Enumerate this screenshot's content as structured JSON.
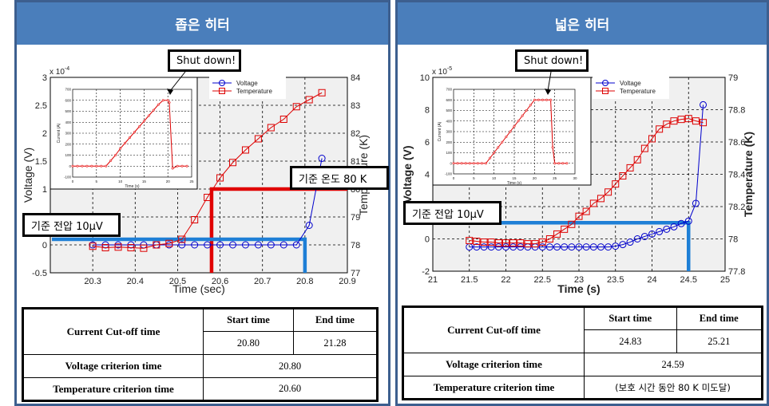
{
  "panels": [
    {
      "title": "좁은 히터",
      "callouts": {
        "shutdown": "Shut down!",
        "temp_ref": "기준 온도 80 K",
        "volt_ref": "기준 전압 10μV"
      },
      "table": {
        "row1_label": "Current Cut-off time",
        "start_header": "Start time",
        "end_header": "End  time",
        "start_value": "20.80",
        "end_value": "21.28",
        "row2_label": "Voltage criterion time",
        "row2_value": "20.80",
        "row3_label": "Temperature criterion time",
        "row3_value": "20.60"
      }
    },
    {
      "title": "넓은 히터",
      "callouts": {
        "shutdown": "Shut down!",
        "volt_ref": "기준 전압 10μV"
      },
      "table": {
        "row1_label": "Current Cut-off time",
        "start_header": "Start time",
        "end_header": "End  time",
        "start_value": "24.83",
        "end_value": "25.21",
        "row2_label": "Voltage criterion time",
        "row2_value": "24.59",
        "row3_label": "Temperature criterion time",
        "row3_value": "(보호 시간 동안 80 K 미도달)"
      }
    }
  ],
  "chart_data": [
    {
      "type": "line",
      "title": "",
      "xlabel": "Time (sec)",
      "ylabel": "Voltage (V)",
      "y2label": "Temperature (K)",
      "yscale_note": "x 10^-4",
      "xlim": [
        20.2,
        20.9
      ],
      "ylim": [
        -0.5,
        3
      ],
      "y2lim": [
        77,
        84
      ],
      "xticks": [
        "20.3",
        "20.4",
        "20.5",
        "20.6",
        "20.7",
        "20.8",
        "20.9"
      ],
      "yticks": [
        "-0.5",
        "0",
        "0.5",
        "1",
        "1.5",
        "2",
        "2.5",
        "3"
      ],
      "y2ticks": [
        "77",
        "78",
        "79",
        "80",
        "81",
        "82",
        "83",
        "84"
      ],
      "grid": true,
      "legend": {
        "position": "top-right",
        "entries": [
          "Voltage",
          "Temperature"
        ]
      },
      "series": [
        {
          "name": "Voltage",
          "color": "#0000cc",
          "marker": "circle",
          "axis": "left",
          "x": [
            20.3,
            20.33,
            20.36,
            20.39,
            20.42,
            20.45,
            20.48,
            20.51,
            20.54,
            20.57,
            20.6,
            20.63,
            20.66,
            20.69,
            20.72,
            20.75,
            20.78,
            20.81,
            20.84
          ],
          "y": [
            0,
            0,
            0,
            0,
            0,
            0,
            0,
            0,
            0,
            0,
            0,
            0,
            0,
            0,
            0,
            0,
            0,
            0.35,
            1.55
          ]
        },
        {
          "name": "Temperature",
          "color": "#dd0000",
          "marker": "square",
          "axis": "right",
          "x": [
            20.3,
            20.33,
            20.36,
            20.39,
            20.42,
            20.45,
            20.48,
            20.51,
            20.54,
            20.57,
            20.6,
            20.63,
            20.66,
            20.69,
            20.72,
            20.75,
            20.78,
            20.81,
            20.84
          ],
          "y": [
            77.95,
            77.9,
            77.92,
            77.9,
            77.88,
            78.0,
            78.05,
            78.2,
            78.9,
            79.7,
            80.4,
            80.95,
            81.4,
            81.8,
            82.2,
            82.5,
            82.95,
            83.2,
            83.45
          ]
        }
      ],
      "reference_lines": [
        {
          "name": "temperature-criterion",
          "color": "#e00000",
          "y2": 80,
          "x": 20.58
        },
        {
          "name": "voltage-criterion",
          "color": "#1e7fd6",
          "y": 0.1,
          "x": 20.8
        }
      ],
      "inset": {
        "xlabel": "Time (s)",
        "ylabel": "Current (A)",
        "xlim": [
          0,
          25
        ],
        "ylim": [
          -100,
          700
        ],
        "xticks": [
          "0",
          "5",
          "10",
          "15",
          "20",
          "25"
        ],
        "yticks": [
          "-100",
          "0",
          "100",
          "200",
          "300",
          "400",
          "500",
          "600",
          "700"
        ],
        "x": [
          0,
          1,
          2,
          3,
          4,
          5,
          6,
          7,
          8,
          9,
          10,
          11,
          12,
          13,
          14,
          15,
          16,
          17,
          18,
          19,
          20,
          20.3,
          21,
          22,
          23,
          24
        ],
        "y": [
          0,
          0,
          0,
          0,
          0,
          0,
          0,
          0,
          50,
          100,
          160,
          210,
          260,
          310,
          360,
          410,
          460,
          510,
          560,
          600,
          600,
          580,
          -20,
          0,
          0,
          0
        ]
      }
    },
    {
      "type": "line",
      "title": "",
      "xlabel": "Time (s)",
      "ylabel": "Voltage (V)",
      "y2label": "Temperature (K)",
      "yscale_note": "x 10^-5",
      "xlim": [
        21,
        25
      ],
      "ylim": [
        -2,
        10
      ],
      "y2lim": [
        77.8,
        79
      ],
      "xticks": [
        "21",
        "21.5",
        "22",
        "22.5",
        "23",
        "23.5",
        "24",
        "24.5",
        "25"
      ],
      "yticks": [
        "-2",
        "0",
        "2",
        "4",
        "6",
        "8",
        "10"
      ],
      "y2ticks": [
        "77.8",
        "78",
        "78.2",
        "78.4",
        "78.6",
        "78.8",
        "79"
      ],
      "grid": true,
      "legend": {
        "position": "top-right",
        "entries": [
          "Voltage",
          "Temperature"
        ]
      },
      "series": [
        {
          "name": "Voltage",
          "color": "#0000cc",
          "marker": "circle",
          "axis": "left",
          "x": [
            21.5,
            21.6,
            21.7,
            21.8,
            21.9,
            22.0,
            22.1,
            22.2,
            22.3,
            22.4,
            22.5,
            22.6,
            22.7,
            22.8,
            22.9,
            23.0,
            23.1,
            23.2,
            23.3,
            23.4,
            23.5,
            23.6,
            23.7,
            23.8,
            23.9,
            24.0,
            24.1,
            24.2,
            24.3,
            24.4,
            24.5,
            24.6,
            24.7
          ],
          "y": [
            -0.5,
            -0.5,
            -0.5,
            -0.5,
            -0.5,
            -0.5,
            -0.5,
            -0.5,
            -0.5,
            -0.5,
            -0.5,
            -0.5,
            -0.5,
            -0.5,
            -0.5,
            -0.5,
            -0.5,
            -0.5,
            -0.5,
            -0.5,
            -0.45,
            -0.35,
            -0.2,
            0,
            0.15,
            0.3,
            0.45,
            0.6,
            0.75,
            0.95,
            1.1,
            2.2,
            8.3
          ]
        },
        {
          "name": "Temperature",
          "color": "#dd0000",
          "marker": "square",
          "axis": "right",
          "x": [
            21.5,
            21.6,
            21.7,
            21.8,
            21.9,
            22.0,
            22.1,
            22.2,
            22.3,
            22.4,
            22.5,
            22.6,
            22.7,
            22.8,
            22.9,
            23.0,
            23.1,
            23.2,
            23.3,
            23.4,
            23.5,
            23.6,
            23.7,
            23.8,
            23.9,
            24.0,
            24.1,
            24.2,
            24.3,
            24.4,
            24.5,
            24.6,
            24.7
          ],
          "y": [
            77.99,
            77.985,
            77.98,
            77.98,
            77.975,
            77.975,
            77.975,
            77.975,
            77.97,
            77.97,
            77.98,
            78.0,
            78.03,
            78.06,
            78.09,
            78.14,
            78.17,
            78.22,
            78.25,
            78.29,
            78.34,
            78.39,
            78.44,
            78.49,
            78.56,
            78.62,
            78.68,
            78.71,
            78.73,
            78.74,
            78.745,
            78.73,
            78.72
          ]
        }
      ],
      "reference_lines": [
        {
          "name": "voltage-criterion",
          "color": "#1e7fd6",
          "y": 1,
          "x": 24.5
        }
      ],
      "inset": {
        "xlabel": "Time (s)",
        "ylabel": "Current (A)",
        "xlim": [
          0,
          30
        ],
        "ylim": [
          -100,
          700
        ],
        "xticks": [
          "0",
          "5",
          "10",
          "15",
          "20",
          "25",
          "30"
        ],
        "yticks": [
          "-100",
          "0",
          "100",
          "200",
          "300",
          "400",
          "500",
          "600",
          "700"
        ],
        "x": [
          0,
          1,
          2,
          3,
          4,
          5,
          6,
          7,
          8,
          9,
          10,
          11,
          12,
          13,
          14,
          15,
          16,
          17,
          18,
          19,
          20,
          21,
          22,
          23,
          24,
          24.5,
          25,
          26,
          27,
          28
        ],
        "y": [
          0,
          0,
          0,
          0,
          0,
          0,
          0,
          0,
          0,
          50,
          100,
          150,
          200,
          250,
          300,
          350,
          400,
          450,
          500,
          550,
          600,
          600,
          600,
          600,
          600,
          150,
          0,
          0,
          0,
          0
        ]
      }
    }
  ]
}
